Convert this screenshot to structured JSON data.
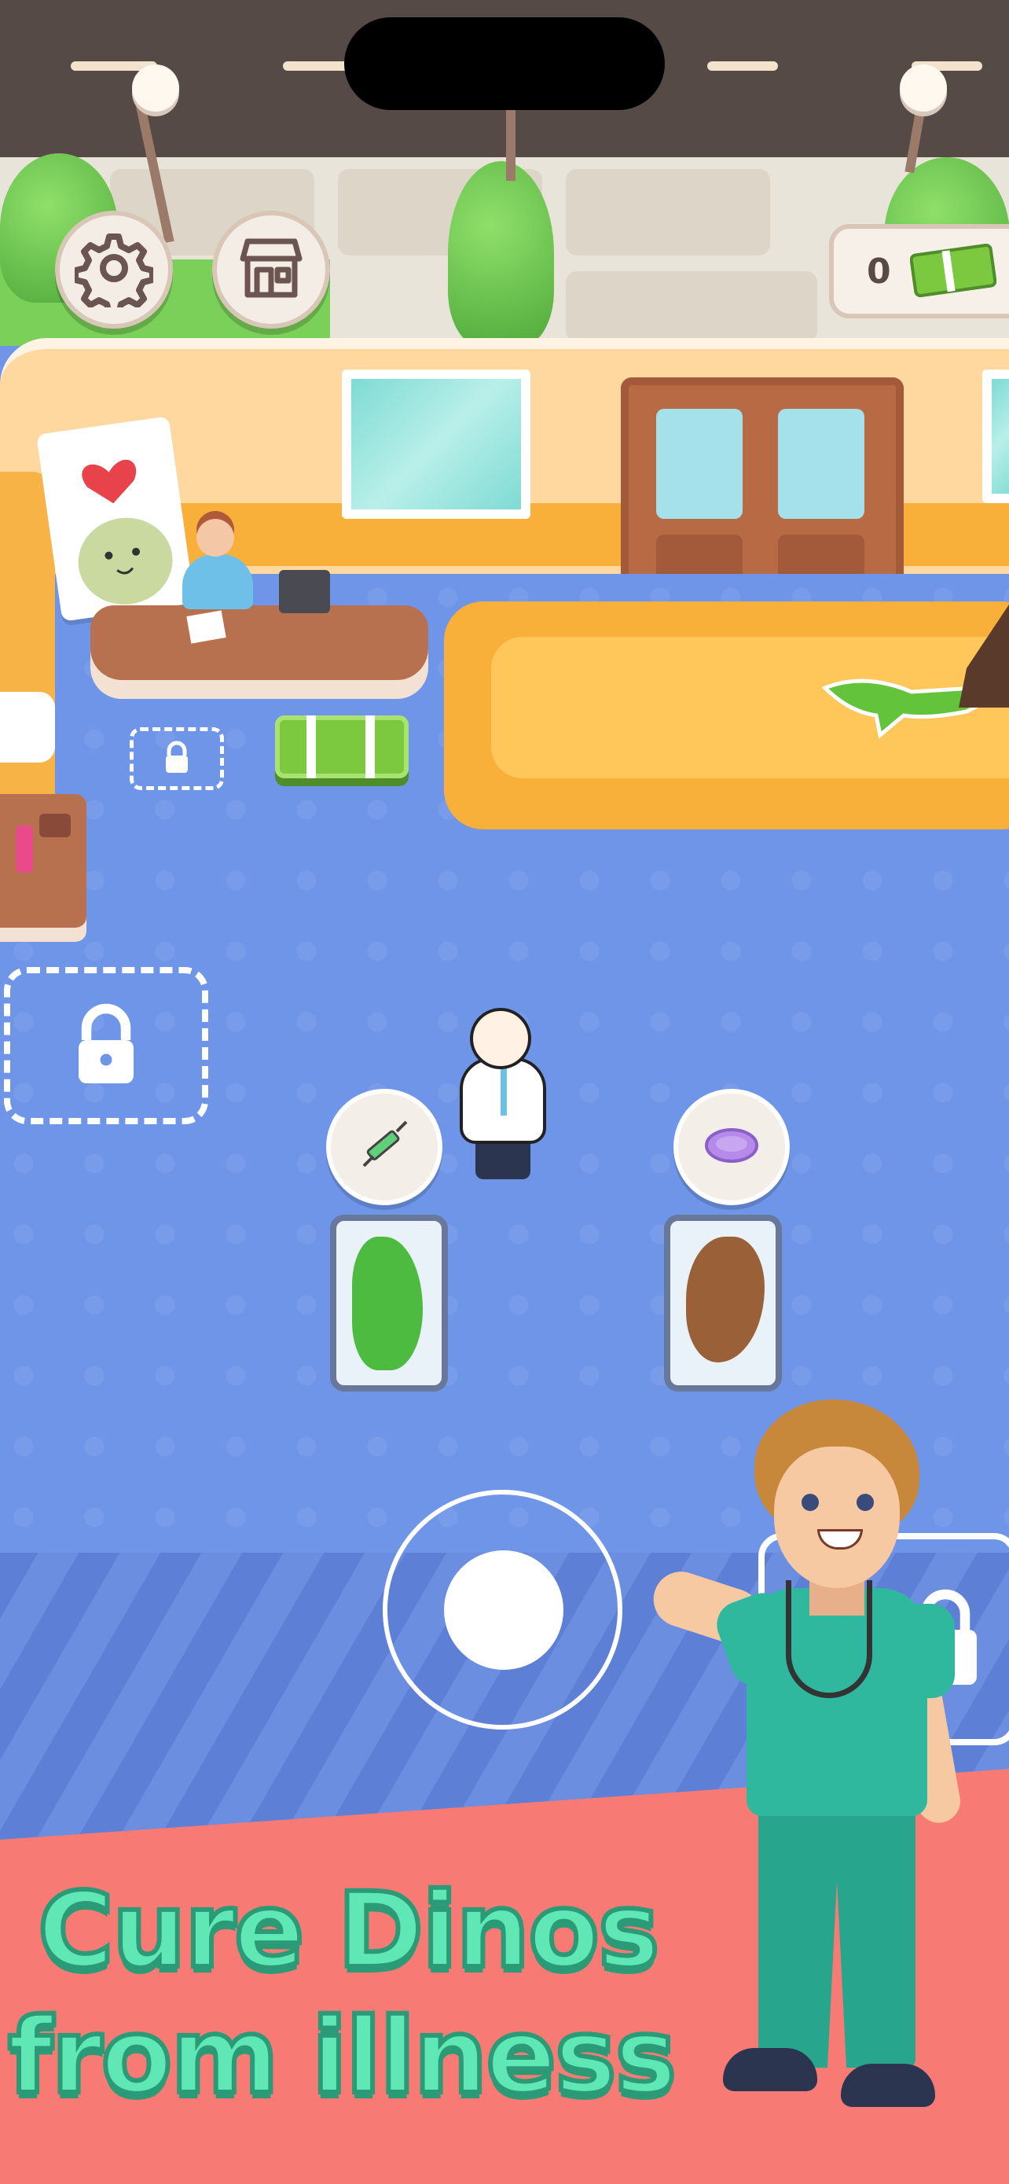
{
  "hud": {
    "settings_icon": "gear-icon",
    "shop_icon": "shop-icon",
    "cash": {
      "value": "0",
      "icon": "cash-icon"
    }
  },
  "scene": {
    "locked_zones": [
      "lock-icon",
      "lock-icon",
      "lock-icon"
    ],
    "beds": [
      {
        "patient": "green-dino",
        "treatment_icon": "syringe-icon"
      },
      {
        "patient": "brown-dino",
        "treatment_icon": "soap-icon"
      }
    ],
    "joystick": "virtual-joystick"
  },
  "banner": {
    "line1": "Cure Dinos",
    "line2": "from illness",
    "text_color": "#5fe8b5",
    "background": "#f77b74"
  },
  "colors": {
    "floor": "#6f95e8",
    "wall": "#ffd8a0",
    "accent": "#f9b03a"
  }
}
